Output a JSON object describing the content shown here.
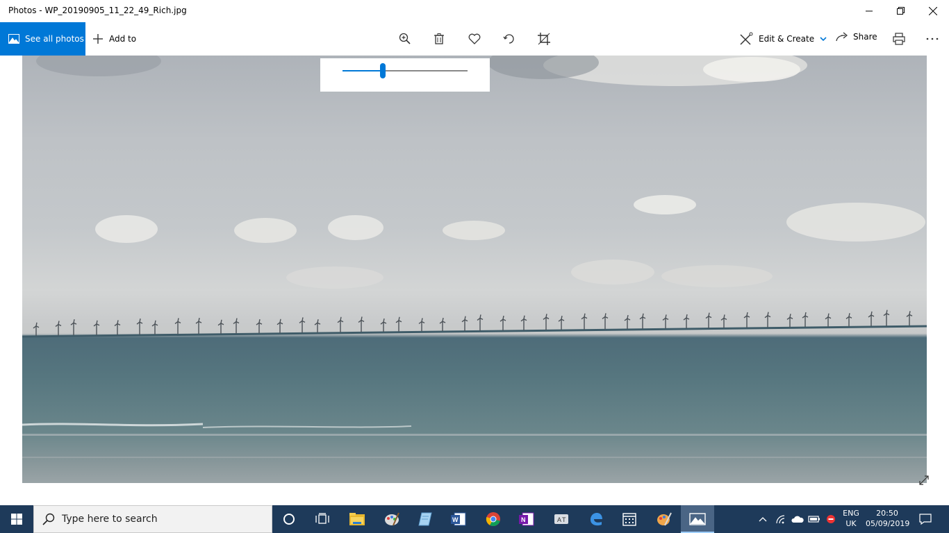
{
  "window": {
    "title": "Photos - WP_20190905_11_22_49_Rich.jpg",
    "controls": [
      "minimize-icon",
      "restore-icon",
      "close-icon"
    ]
  },
  "toolbar": {
    "see_all_label": "See all photos",
    "add_to_label": "Add to",
    "tools": [
      "zoom-icon",
      "delete-icon",
      "favorite-icon",
      "rotate-icon",
      "crop-icon"
    ],
    "edit_create_label": "Edit & Create",
    "share_label": "Share",
    "print_icon": "print-icon",
    "more_icon": "more-icon"
  },
  "zoom": {
    "level": 0.32
  },
  "taskbar": {
    "search_placeholder": "Type here to search",
    "apps": [
      "cortana-icon",
      "task-view-icon",
      "file-explorer-icon",
      "paint-icon",
      "notepad-icon",
      "word-icon",
      "chrome-icon",
      "onenote-icon",
      "translator-icon",
      "edge-icon",
      "calendar-icon",
      "paint3d-icon",
      "photos-icon"
    ],
    "active_app": "photos-icon",
    "tray": [
      "chevron-up-icon",
      "wifi-icon",
      "onedrive-icon",
      "battery-icon",
      "security-icon"
    ],
    "language": [
      "ENG",
      "UK"
    ],
    "time": "20:50",
    "date": "05/09/2019"
  },
  "colors": {
    "accent": "#0078d7",
    "taskbar": "#1e3a5a",
    "taskbar_active": "#4a6585"
  }
}
